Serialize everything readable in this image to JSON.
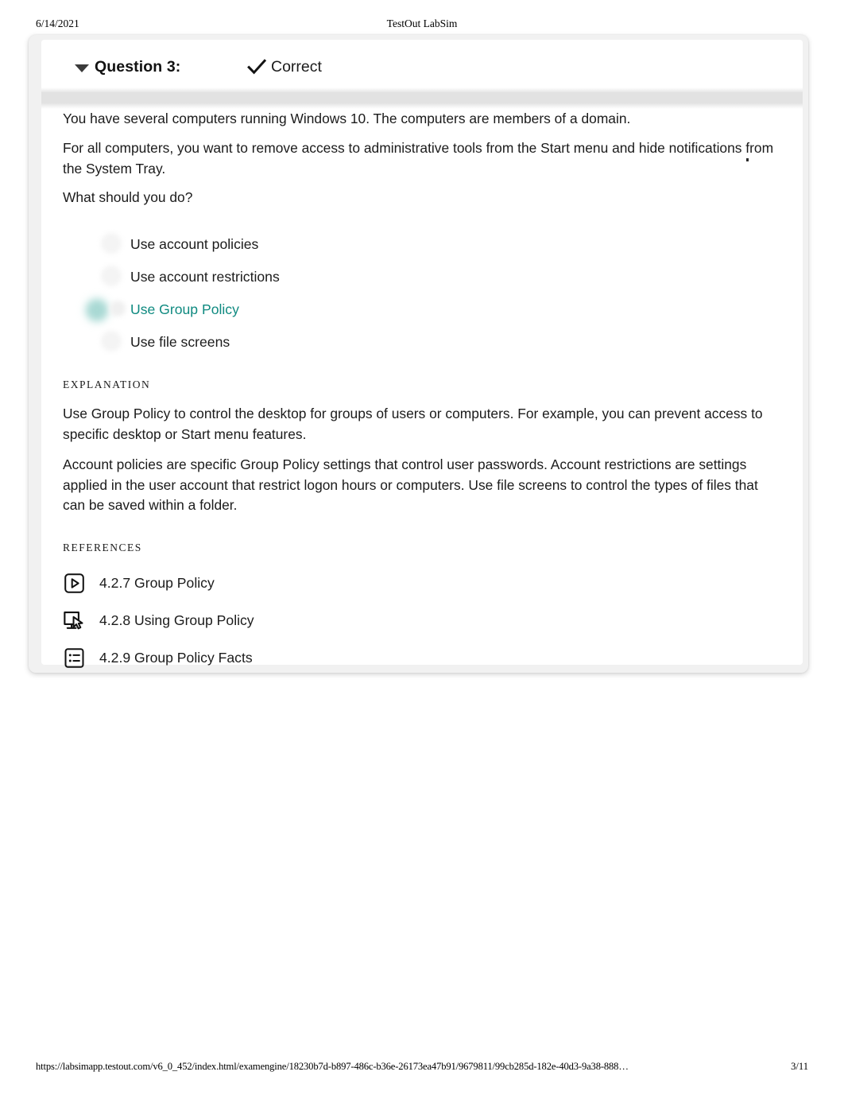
{
  "print_header": {
    "date": "6/14/2021",
    "title": "TestOut LabSim"
  },
  "print_footer": {
    "url": "https://labsimapp.testout.com/v6_0_452/index.html/examengine/18230b7d-b897-486c-b36e-26173ea47b91/9679811/99cb285d-182e-40d3-9a38-888…",
    "page": "3/11"
  },
  "question_card": {
    "header": {
      "caret_icon": "caret-down-icon",
      "question_label": "Question 3:",
      "status_icon": "checkmark-icon",
      "status_text": "Correct"
    },
    "prompt": [
      "You have several computers running Windows 10. The computers are members of a domain.",
      "For all computers, you want to remove access to administrative tools from the Start menu and hide notifications from the System Tray.",
      "What should you do?"
    ],
    "options": [
      {
        "label": "Use account policies",
        "selected": false
      },
      {
        "label": "Use account restrictions",
        "selected": false
      },
      {
        "label": "Use Group Policy",
        "selected": true
      },
      {
        "label": "Use file screens",
        "selected": false
      }
    ],
    "explanation": {
      "heading": "EXPLANATION",
      "paragraphs": [
        "Use Group Policy to control the desktop for groups of users or computers. For example, you can prevent access to specific desktop or Start menu features.",
        "Account policies are specific Group Policy settings that control user passwords. Account restrictions are settings applied in the user account that restrict logon hours or computers. Use file screens to control the types of files that can be saved within a folder."
      ]
    },
    "references": {
      "heading": "REFERENCES",
      "items": [
        {
          "icon": "video-play-icon",
          "label": "4.2.7 Group Policy"
        },
        {
          "icon": "lab-monitor-cursor-icon",
          "label": "4.2.8 Using Group Policy"
        },
        {
          "icon": "facts-list-icon",
          "label": "4.2.9 Group Policy Facts"
        }
      ]
    }
  },
  "colors": {
    "selected_answer": "#0f8a80",
    "text": "#1b1b1b",
    "card_outer": "#f1f1f1",
    "divider": "#e2e2e2"
  }
}
